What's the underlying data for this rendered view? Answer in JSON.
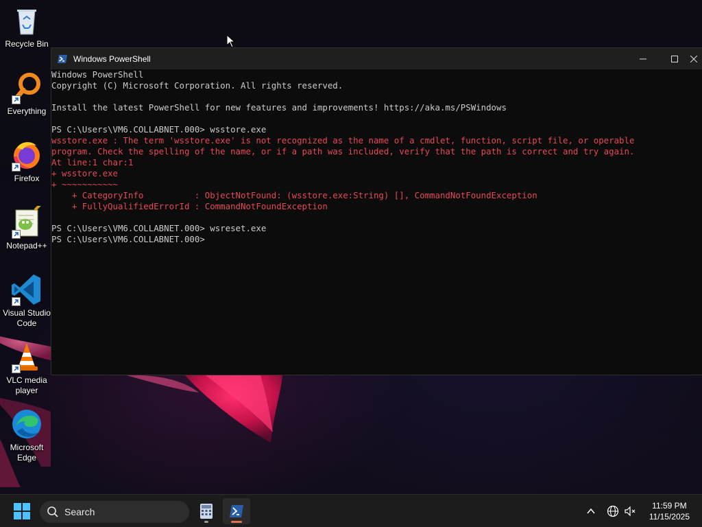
{
  "desktop": {
    "icons": [
      {
        "label": "Recycle Bin",
        "icon": "recycle-bin-icon"
      },
      {
        "label": "Everything",
        "icon": "everything-search-icon"
      },
      {
        "label": "Firefox",
        "icon": "firefox-icon"
      },
      {
        "label": "Notepad++",
        "icon": "notepad-plus-plus-icon"
      },
      {
        "label": "Visual Studio Code",
        "icon": "vscode-icon"
      },
      {
        "label": "VLC media player",
        "icon": "vlc-icon"
      },
      {
        "label": "Microsoft Edge",
        "icon": "edge-icon"
      }
    ]
  },
  "window": {
    "title": "Windows PowerShell",
    "terminal_lines": [
      {
        "text": "Windows PowerShell",
        "type": "normal"
      },
      {
        "text": "Copyright (C) Microsoft Corporation. All rights reserved.",
        "type": "normal"
      },
      {
        "text": "",
        "type": "normal"
      },
      {
        "text": "Install the latest PowerShell for new features and improvements! https://aka.ms/PSWindows",
        "type": "normal"
      },
      {
        "text": "",
        "type": "normal"
      },
      {
        "text": "PS C:\\Users\\VM6.COLLABNET.000> wsstore.exe",
        "type": "normal"
      },
      {
        "text": "wsstore.exe : The term 'wsstore.exe' is not recognized as the name of a cmdlet, function, script file, or operable",
        "type": "error"
      },
      {
        "text": "program. Check the spelling of the name, or if a path was included, verify that the path is correct and try again.",
        "type": "error"
      },
      {
        "text": "At line:1 char:1",
        "type": "error"
      },
      {
        "text": "+ wsstore.exe",
        "type": "error"
      },
      {
        "text": "+ ~~~~~~~~~~~",
        "type": "error"
      },
      {
        "text": "    + CategoryInfo          : ObjectNotFound: (wsstore.exe:String) [], CommandNotFoundException",
        "type": "error"
      },
      {
        "text": "    + FullyQualifiedErrorId : CommandNotFoundException",
        "type": "error"
      },
      {
        "text": "",
        "type": "normal"
      },
      {
        "text": "PS C:\\Users\\VM6.COLLABNET.000> wsreset.exe",
        "type": "normal"
      },
      {
        "text": "PS C:\\Users\\VM6.COLLABNET.000>",
        "type": "normal"
      }
    ]
  },
  "taskbar": {
    "search_label": "Search",
    "time": "11:59 PM",
    "date": "11/15/2025"
  },
  "colors": {
    "error_text": "#e74856",
    "terminal_text": "#cccccc",
    "terminal_bg": "#0c0c0c",
    "accent_indicator": "#e8734a"
  }
}
